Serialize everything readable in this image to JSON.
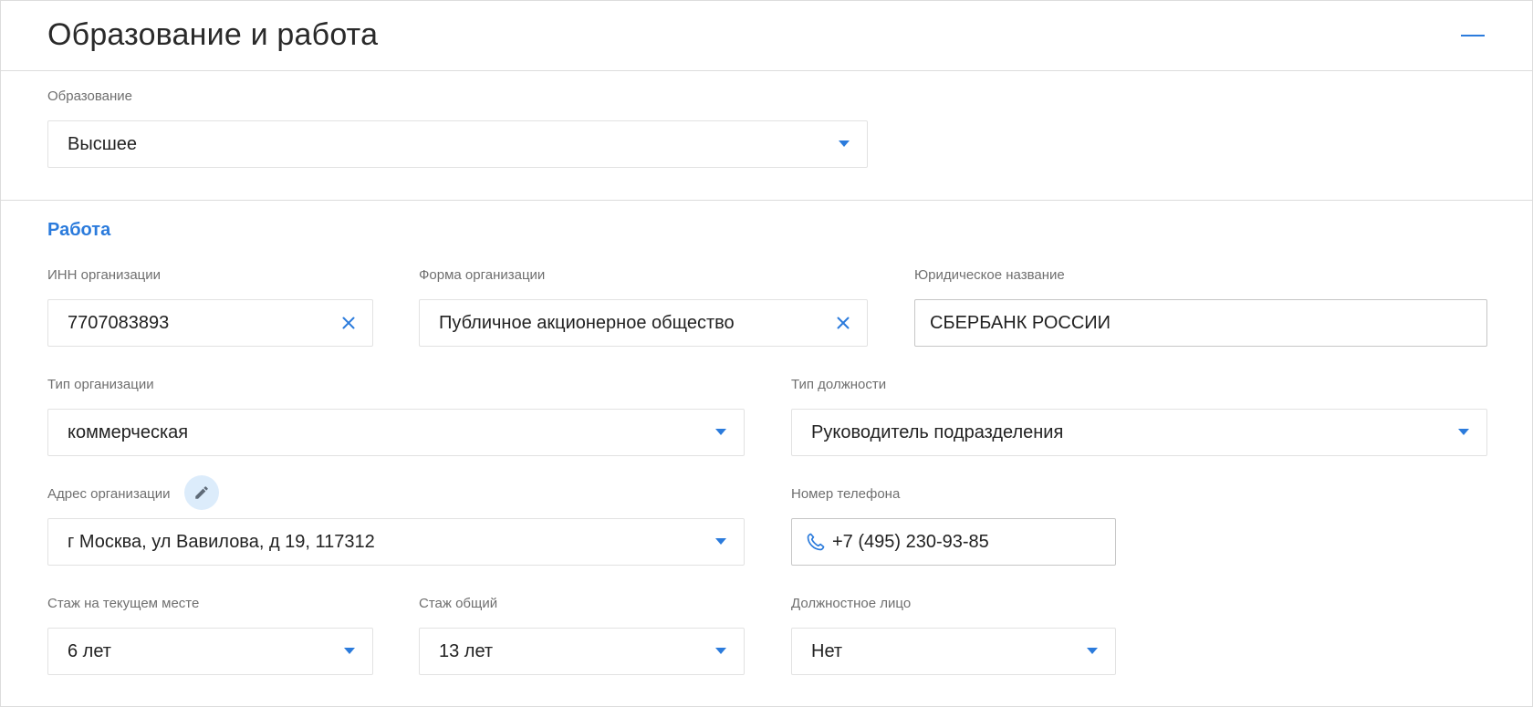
{
  "header": {
    "title": "Образование и работа"
  },
  "education": {
    "label": "Образование",
    "value": "Высшее"
  },
  "work": {
    "title": "Работа",
    "inn": {
      "label": "ИНН организации",
      "value": "7707083893"
    },
    "org_form": {
      "label": "Форма организации",
      "value": "Публичное акционерное общество"
    },
    "legal_name": {
      "label": "Юридическое название",
      "value": "СБЕРБАНК РОССИИ"
    },
    "org_type": {
      "label": "Тип организации",
      "value": "коммерческая"
    },
    "position_type": {
      "label": "Тип должности",
      "value": "Руководитель подразделения"
    },
    "org_address": {
      "label": "Адрес организации",
      "value": "г Москва, ул Вавилова, д 19, 117312"
    },
    "phone": {
      "label": "Номер телефона",
      "value": "+7 (495) 230-93-85"
    },
    "experience_current": {
      "label": "Стаж на текущем месте",
      "value": "6 лет"
    },
    "experience_total": {
      "label": "Стаж общий",
      "value": "13 лет"
    },
    "official": {
      "label": "Должностное лицо",
      "value": "Нет"
    }
  },
  "icons": {
    "collapse": "minus-icon",
    "dropdown": "chevron-down-icon",
    "clear": "close-icon",
    "edit": "pencil-icon",
    "phone": "phone-icon"
  },
  "colors": {
    "accent": "#2b7bdc",
    "edit_bg": "#dcecfb",
    "border": "#e2e2e2",
    "label": "#6f6f6f"
  }
}
